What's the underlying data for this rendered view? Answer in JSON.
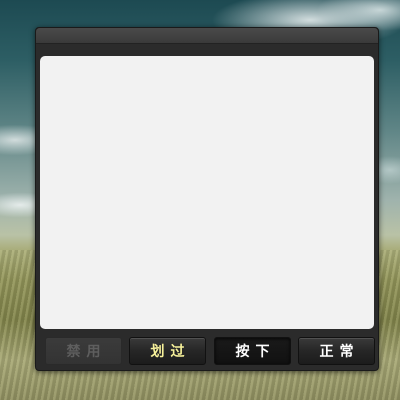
{
  "window": {
    "title": ""
  },
  "buttons": [
    {
      "label": "禁用",
      "state": "disabled",
      "color": "#5e5e5e"
    },
    {
      "label": "划过",
      "state": "hover",
      "color": "#f7f19a"
    },
    {
      "label": "按下",
      "state": "pressed",
      "color": "#ffffff"
    },
    {
      "label": "正常",
      "state": "normal",
      "color": "#ffffff"
    }
  ],
  "colors": {
    "window_bg": "#2b2b2b",
    "content_bg": "#f2f2f2",
    "titlebar": "#444444"
  }
}
